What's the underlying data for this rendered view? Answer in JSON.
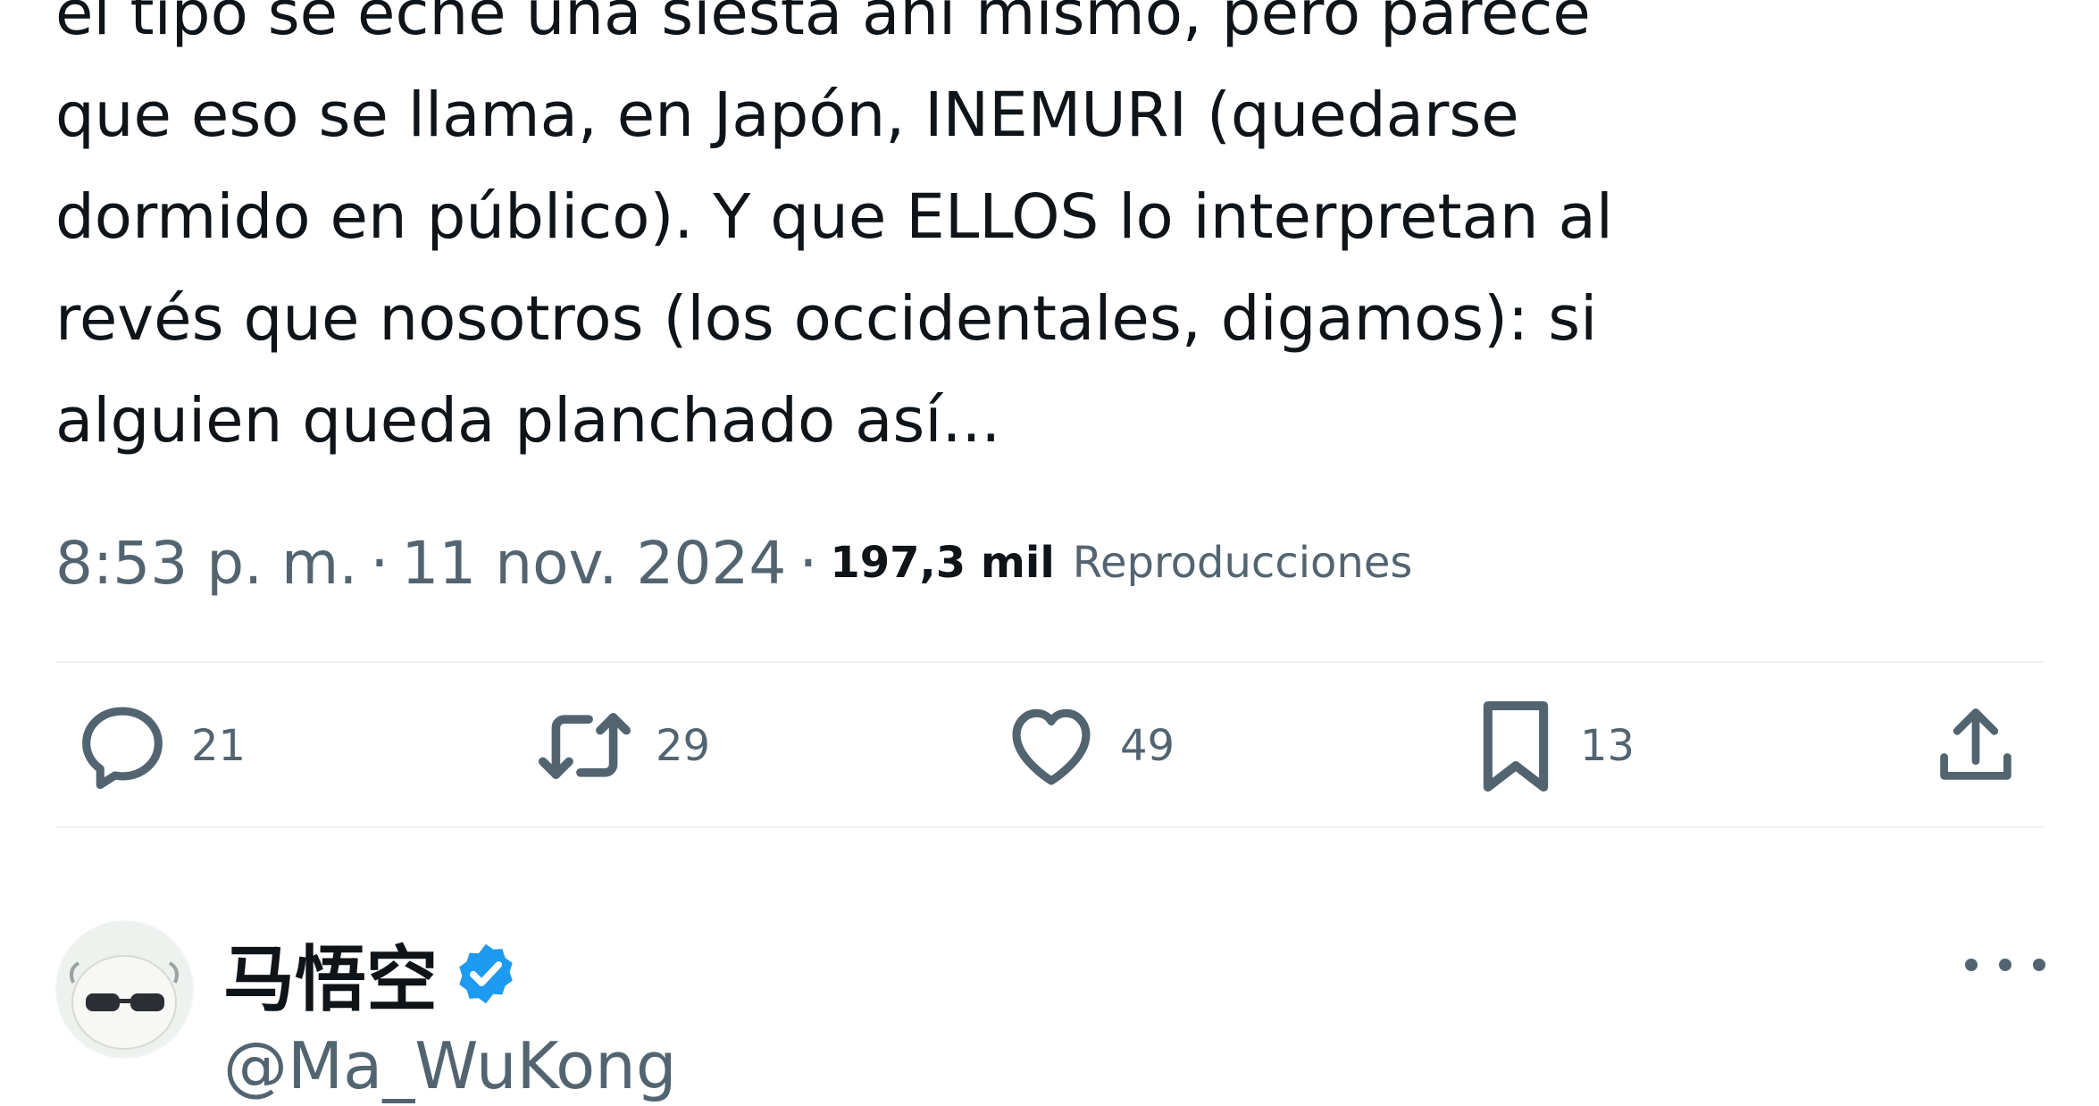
{
  "tweet": {
    "text_lines": [
      "el tipo se eche una siesta ahí mismo, pero parece",
      "que eso se llama, en Japón, INEMURI (quedarse",
      "dormido en público). Y que ELLOS lo interpretan al",
      "revés que nosotros (los occidentales, digamos): si",
      "alguien queda planchado así..."
    ],
    "time": "8:53 p. m.",
    "separator": "·",
    "date": "11 nov. 2024",
    "views_count": "197,3 mil",
    "views_label": "Reproducciones"
  },
  "actions": {
    "reply": {
      "icon": "reply-icon",
      "count": "21"
    },
    "retweet": {
      "icon": "retweet-icon",
      "count": "29"
    },
    "like": {
      "icon": "heart-icon",
      "count": "49"
    },
    "bookmark": {
      "icon": "bookmark-icon",
      "count": "13"
    },
    "share": {
      "icon": "share-icon"
    }
  },
  "next_tweet": {
    "author_name": "马悟空",
    "verified": true,
    "handle": "@Ma_WuKong",
    "more_icon": "more-options-icon"
  },
  "colors": {
    "text_primary": "#0f1419",
    "text_secondary": "#536471",
    "divider": "#eff3f4",
    "verified_blue": "#1d9bf0"
  }
}
